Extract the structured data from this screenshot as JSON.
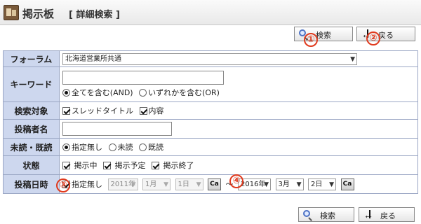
{
  "header": {
    "title": "掲示板",
    "subtitle": "[ 詳細検索 ]",
    "app_icon": "bulletin-board-icon"
  },
  "toolbar": {
    "search_label": "検索",
    "back_label": "戻る"
  },
  "callouts": {
    "search": "①",
    "back": "②",
    "no_date": "③",
    "calendar": "④"
  },
  "form": {
    "forum": {
      "label": "フォーラム",
      "value": "北海道営業所共通"
    },
    "keyword": {
      "label": "キーワード",
      "value": "",
      "opt_and": "全てを含む(AND)",
      "opt_or": "いずれかを含む(OR)",
      "selected": "AND"
    },
    "target": {
      "label": "検索対象",
      "opt_title": "スレッドタイトル",
      "opt_body": "内容",
      "title_checked": true,
      "body_checked": true
    },
    "author": {
      "label": "投稿者名",
      "value": ""
    },
    "read": {
      "label": "未読・既読",
      "opt_none": "指定無し",
      "opt_unread": "未読",
      "opt_read": "既読",
      "selected": "指定無し"
    },
    "state": {
      "label": "状態",
      "opt_active": "掲示中",
      "opt_scheduled": "掲示予定",
      "opt_ended": "掲示終了"
    },
    "date": {
      "label": "投稿日時",
      "no_date": "指定無し",
      "from": {
        "year": "2011年",
        "month": "1月",
        "day": "1日"
      },
      "sep": "～",
      "to": {
        "year": "2016年",
        "month": "3月",
        "day": "2日"
      },
      "cal_label": "Ca"
    }
  },
  "colors": {
    "header_bg": "#cdd7ee",
    "border": "#9aa6c4",
    "callout": "#e03a1e"
  }
}
